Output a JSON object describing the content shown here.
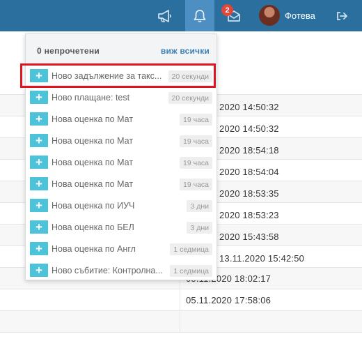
{
  "navbar": {
    "mail_badge": "2",
    "user_name": "Фотева"
  },
  "dropdown": {
    "title": "0 непрочетени",
    "view_all": "виж всички",
    "items": [
      {
        "text": "Ново задължение за такс...",
        "time": "20 секунди"
      },
      {
        "text": "Ново плащане: test",
        "time": "20 секунди"
      },
      {
        "text": "Нова оценка по Мат",
        "time": "19 часа"
      },
      {
        "text": "Нова оценка по Мат",
        "time": "19 часа"
      },
      {
        "text": "Нова оценка по Мат",
        "time": "19 часа"
      },
      {
        "text": "Нова оценка по Мат",
        "time": "19 часа"
      },
      {
        "text": "Нова оценка по ИУЧ",
        "time": "3 дни"
      },
      {
        "text": "Нова оценка по БЕЛ",
        "time": "3 дни"
      },
      {
        "text": "Нова оценка по Англ",
        "time": "1 седмица"
      },
      {
        "text": "Ново събитие: Контролна...",
        "time": "1 седмица"
      }
    ]
  },
  "table": {
    "dates": [
      "",
      "",
      "2020 14:50:32",
      "2020 14:50:32",
      "2020 18:54:18",
      "2020 18:54:04",
      "2020 18:53:35",
      "2020 18:53:23",
      "2020 15:43:58",
      "13.11.2020 15:42:50",
      "05.11.2020 18:02:17",
      "05.11.2020 17:58:06"
    ]
  },
  "colors": {
    "navbar": "#2b6f9e",
    "bell_active": "#4d8fc2",
    "plus_icon": "#4cc3d9",
    "highlight": "#e0141e"
  }
}
